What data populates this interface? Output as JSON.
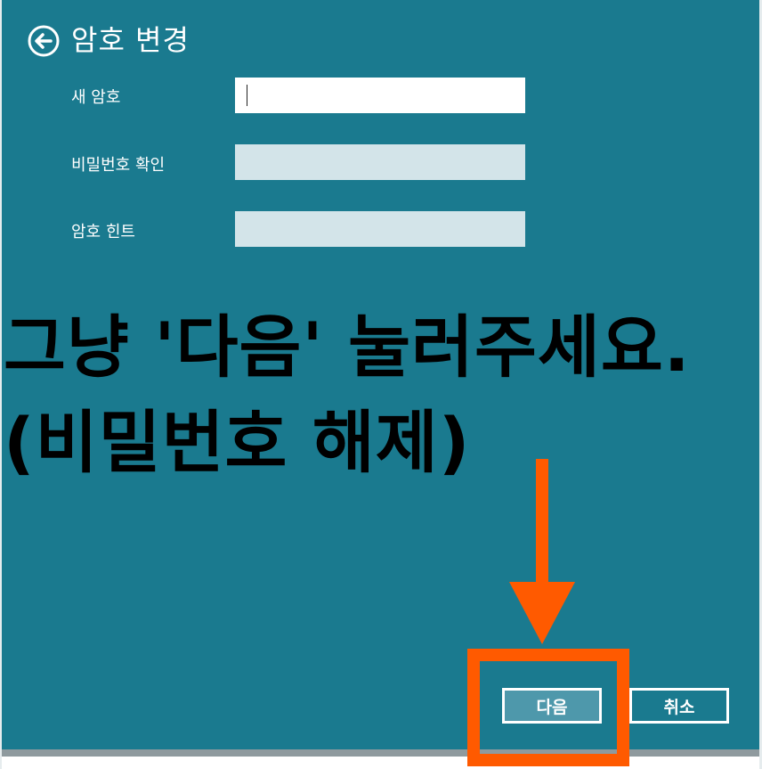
{
  "dialog": {
    "title": "암호 변경",
    "back_icon": "back-arrow-circle-icon"
  },
  "form": {
    "new_password_label": "새 암호",
    "new_password_value": "",
    "confirm_password_label": "비밀번호 확인",
    "confirm_password_value": "",
    "hint_label": "암호 힌트",
    "hint_value": ""
  },
  "annotation": {
    "line1": "그냥 '다음' 눌러주세요.",
    "line2": "(비밀번호 해제)",
    "highlight_color": "#ff5a00",
    "arrow_icon": "down-arrow-icon"
  },
  "buttons": {
    "next_label": "다음",
    "cancel_label": "취소"
  },
  "colors": {
    "background": "#1a7a8f",
    "field_active": "#ffffff",
    "field_inactive": "#d3e4e9",
    "next_button": "#4e98ab"
  }
}
